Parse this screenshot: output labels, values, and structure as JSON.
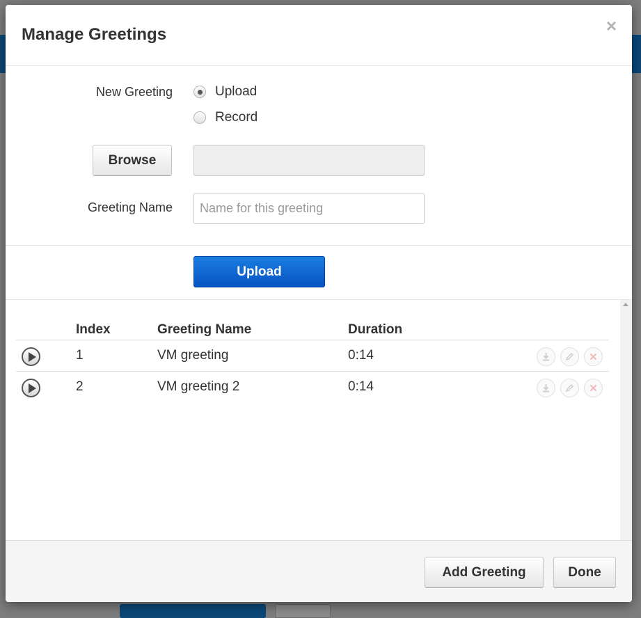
{
  "dialog": {
    "title": "Manage Greetings",
    "close_label": "×"
  },
  "form": {
    "new_greeting_label": "New Greeting",
    "options": [
      {
        "label": "Upload",
        "checked": true
      },
      {
        "label": "Record",
        "checked": false
      }
    ],
    "browse_label": "Browse",
    "file_value": "",
    "greeting_name_label": "Greeting Name",
    "greeting_name_placeholder": "Name for this greeting",
    "greeting_name_value": "",
    "upload_button_label": "Upload"
  },
  "table": {
    "columns": [
      "Index",
      "Greeting Name",
      "Duration"
    ],
    "rows": [
      {
        "index": "1",
        "name": "VM greeting",
        "duration": "0:14"
      },
      {
        "index": "2",
        "name": "VM greeting 2",
        "duration": "0:14"
      }
    ],
    "row_actions": [
      "download-icon",
      "edit-icon",
      "delete-icon"
    ]
  },
  "footer": {
    "add_greeting_label": "Add Greeting",
    "done_label": "Done"
  },
  "colors": {
    "primary": "#0a63d4",
    "delete_icon": "#f2b8b8",
    "muted_icon": "#d6d6d6"
  }
}
